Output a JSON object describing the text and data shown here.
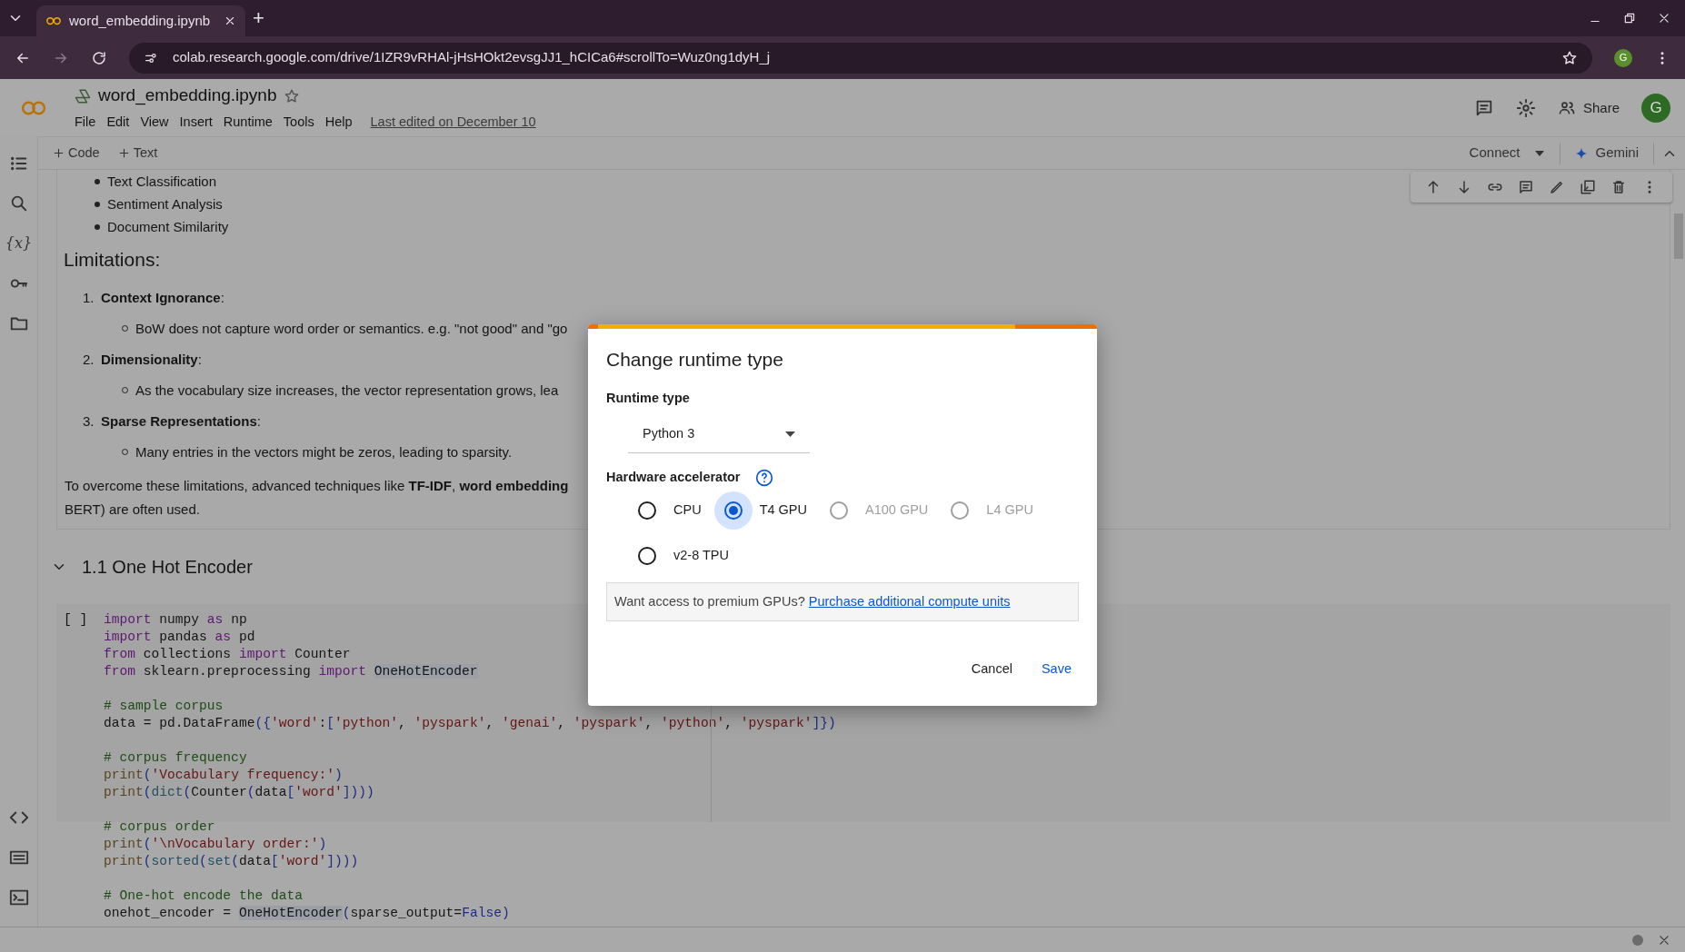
{
  "browser": {
    "tab_title": "word_embedding.ipynb",
    "new_tab": "+",
    "url": "colab.research.google.com/drive/1IZR9vRHAl-jHsHOkt2evsgJJ1_hCICa6#scrollTo=Wuz0ng1dyH_j",
    "profile_initial": "G"
  },
  "notebook": {
    "title": "word_embedding.ipynb",
    "menu": [
      "File",
      "Edit",
      "View",
      "Insert",
      "Runtime",
      "Tools",
      "Help"
    ],
    "last_edited": "Last edited on December 10",
    "share": "Share",
    "avatar_initial": "G"
  },
  "toolbar": {
    "add_buttons": [
      "Code",
      "Text"
    ],
    "connect": "Connect",
    "gemini": "Gemini"
  },
  "sidebar": {
    "variables_icon": "{x}"
  },
  "markdown": {
    "bullets": [
      "Text Classification",
      "Sentiment Analysis",
      "Document Similarity"
    ],
    "heading": "Limitations:",
    "limitations": [
      {
        "number": "1.",
        "title": "**Context Ignorance**:",
        "detail": "BoW does not capture word order or semantics. e.g. \"not good\" and \"go"
      },
      {
        "number": "2.",
        "title": "**Dimensionality**:",
        "detail": "As the vocabulary size increases, the vector representation grows, lea"
      },
      {
        "number": "3.",
        "title": "**Sparse Representations**:",
        "detail": "Many entries in the vectors might be zeros, leading to sparsity."
      }
    ],
    "closing_lines": [
      "To overcome these limitations, advanced techniques like **TF-IDF**, **word embedding**",
      "BERT) are often used."
    ]
  },
  "section": {
    "title": "1.1 One Hot Encoder",
    "expanded": true
  },
  "code_cell": {
    "run_marker": "[ ]",
    "blocks": [
      [
        [
          {
            "kind": "kw",
            "text": "import"
          },
          {
            "kind": "tx",
            "text": " numpy "
          },
          {
            "kind": "kw",
            "text": "as"
          },
          {
            "kind": "tx",
            "text": " np"
          }
        ],
        [
          {
            "kind": "kw",
            "text": "import"
          },
          {
            "kind": "tx",
            "text": " pandas "
          },
          {
            "kind": "kw",
            "text": "as"
          },
          {
            "kind": "tx",
            "text": " pd"
          }
        ],
        [
          {
            "kind": "kw",
            "text": "from"
          },
          {
            "kind": "tx",
            "text": " collections "
          },
          {
            "kind": "kw",
            "text": "import"
          },
          {
            "kind": "tx",
            "text": " Counter"
          }
        ],
        [
          {
            "kind": "kw",
            "text": "from"
          },
          {
            "kind": "tx",
            "text": " sklearn.preprocessing "
          },
          {
            "kind": "kw",
            "text": "import "
          },
          {
            "kind": "hl",
            "text": "OneHotEncoder"
          }
        ]
      ],
      [
        [
          {
            "kind": "com",
            "text": "# sample corpus"
          }
        ],
        [
          {
            "kind": "tx",
            "text": "data = pd.DataFrame"
          },
          {
            "kind": "p",
            "text": "({"
          },
          {
            "kind": "str",
            "text": "'word'"
          },
          {
            "kind": "tx",
            "text": ":"
          },
          {
            "kind": "p",
            "text": "["
          },
          {
            "kind": "str",
            "text": "'python'"
          },
          {
            "kind": "tx",
            "text": ", "
          },
          {
            "kind": "str",
            "text": "'pyspark'"
          },
          {
            "kind": "tx",
            "text": ", "
          },
          {
            "kind": "str",
            "text": "'genai'"
          },
          {
            "kind": "tx",
            "text": ", "
          },
          {
            "kind": "str",
            "text": "'pyspark'"
          },
          {
            "kind": "tx",
            "text": ", "
          },
          {
            "kind": "str",
            "text": "'python'"
          },
          {
            "kind": "tx",
            "text": ", "
          },
          {
            "kind": "str",
            "text": "'pyspark'"
          },
          {
            "kind": "p",
            "text": "]})"
          }
        ]
      ],
      [
        [
          {
            "kind": "com",
            "text": "# corpus frequency"
          }
        ],
        [
          {
            "kind": "fn",
            "text": "print"
          },
          {
            "kind": "p",
            "text": "("
          },
          {
            "kind": "str",
            "text": "'Vocabulary frequency:'"
          },
          {
            "kind": "p",
            "text": ")"
          }
        ],
        [
          {
            "kind": "fn",
            "text": "print"
          },
          {
            "kind": "p",
            "text": "("
          },
          {
            "kind": "bi",
            "text": "dict"
          },
          {
            "kind": "p",
            "text": "("
          },
          {
            "kind": "tx",
            "text": "Counter"
          },
          {
            "kind": "p",
            "text": "("
          },
          {
            "kind": "tx",
            "text": "data"
          },
          {
            "kind": "p",
            "text": "["
          },
          {
            "kind": "str",
            "text": "'word'"
          },
          {
            "kind": "p",
            "text": "])))"
          }
        ]
      ],
      [
        [
          {
            "kind": "com",
            "text": "# corpus order"
          }
        ],
        [
          {
            "kind": "fn",
            "text": "print"
          },
          {
            "kind": "p",
            "text": "("
          },
          {
            "kind": "str",
            "text": "'\\nVocabulary order:'"
          },
          {
            "kind": "p",
            "text": ")"
          }
        ],
        [
          {
            "kind": "fn",
            "text": "print"
          },
          {
            "kind": "p",
            "text": "("
          },
          {
            "kind": "bi",
            "text": "sorted"
          },
          {
            "kind": "p",
            "text": "("
          },
          {
            "kind": "bi",
            "text": "set"
          },
          {
            "kind": "p",
            "text": "("
          },
          {
            "kind": "tx",
            "text": "data"
          },
          {
            "kind": "p",
            "text": "["
          },
          {
            "kind": "str",
            "text": "'word'"
          },
          {
            "kind": "p",
            "text": "])))"
          }
        ]
      ],
      [
        [
          {
            "kind": "com",
            "text": "# One-hot encode the data"
          }
        ],
        [
          {
            "kind": "tx",
            "text": "onehot_encoder = "
          },
          {
            "kind": "hl",
            "text": "OneHotEncoder"
          },
          {
            "kind": "p",
            "text": "("
          },
          {
            "kind": "tx",
            "text": "sparse_output="
          },
          {
            "kind": "const",
            "text": "False"
          },
          {
            "kind": "p",
            "text": ")"
          }
        ]
      ]
    ]
  },
  "dialog": {
    "title": "Change runtime type",
    "runtime_label": "Runtime type",
    "runtime_value": "Python 3",
    "accelerator_label": "Hardware accelerator",
    "accelerators": [
      {
        "label": "CPU",
        "selected": false,
        "disabled": false
      },
      {
        "label": "T4 GPU",
        "selected": true,
        "disabled": false
      },
      {
        "label": "A100 GPU",
        "selected": false,
        "disabled": true
      },
      {
        "label": "L4 GPU",
        "selected": false,
        "disabled": true
      },
      {
        "label": "v2-8 TPU",
        "selected": false,
        "disabled": false
      }
    ],
    "note": "Want access to premium GPUs?",
    "note_link": "Purchase additional compute units",
    "buttons": [
      {
        "label": "Cancel",
        "kind": "plain"
      },
      {
        "label": "Save",
        "kind": "primary"
      }
    ]
  }
}
